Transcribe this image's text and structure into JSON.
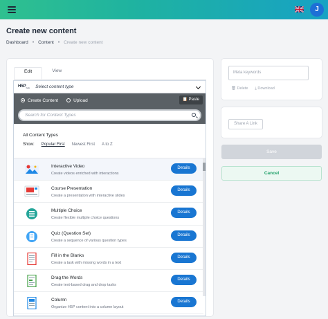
{
  "header": {
    "menu_icon": "hamburger-icon",
    "language_icon": "uk-flag-icon",
    "user_initial": "J"
  },
  "page": {
    "title": "Create new content"
  },
  "breadcrumb": {
    "items": [
      "Dashboard",
      "Content",
      "Create new content"
    ],
    "separator": "•"
  },
  "editor": {
    "tabs": [
      {
        "label": "Edit",
        "active": true
      },
      {
        "label": "View",
        "active": false
      }
    ],
    "hub": {
      "logo": "H5P",
      "logo_sub": "hub",
      "select_placeholder": "Select content type",
      "nav": {
        "create_label": "Create Content",
        "upload_label": "Upload",
        "paste_label": "Paste"
      },
      "search_placeholder": "Search for Content Types",
      "section_title": "All Content Types",
      "show": {
        "label": "Show:",
        "options": [
          "Popular First",
          "Newest First",
          "A to Z"
        ],
        "selected": "Popular First"
      },
      "items": [
        {
          "title": "Interactive Video",
          "desc": "Create videos enriched with interactions",
          "button": "Details",
          "icon": "interactive-video-icon"
        },
        {
          "title": "Course Presentation",
          "desc": "Create a presentation with interactive slides",
          "button": "Details",
          "icon": "course-presentation-icon"
        },
        {
          "title": "Multiple Choice",
          "desc": "Create flexible multiple choice questions",
          "button": "Details",
          "icon": "multiple-choice-icon"
        },
        {
          "title": "Quiz (Question Set)",
          "desc": "Create a sequence of various question types",
          "button": "Details",
          "icon": "quiz-icon"
        },
        {
          "title": "Fill in the Blanks",
          "desc": "Create a task with missing words in a text",
          "button": "Details",
          "icon": "fill-blanks-icon"
        },
        {
          "title": "Drag the Words",
          "desc": "Create text-based drag and drop tasks",
          "button": "Details",
          "icon": "drag-words-icon"
        },
        {
          "title": "Column",
          "desc": "Organize H5P content into a column layout",
          "button": "Details",
          "icon": "column-icon"
        }
      ]
    }
  },
  "sidebar": {
    "meta_placeholder": "Meta keywords",
    "delete_label": "Delete",
    "download_label": "Download",
    "share_label": "Share A Link",
    "save_label": "Save",
    "cancel_label": "Cancel"
  },
  "colors": {
    "accent_blue": "#1976d2",
    "topbar_start": "#2fc08f",
    "topbar_end": "#17a2c4",
    "cancel_green": "#1e9f68"
  }
}
